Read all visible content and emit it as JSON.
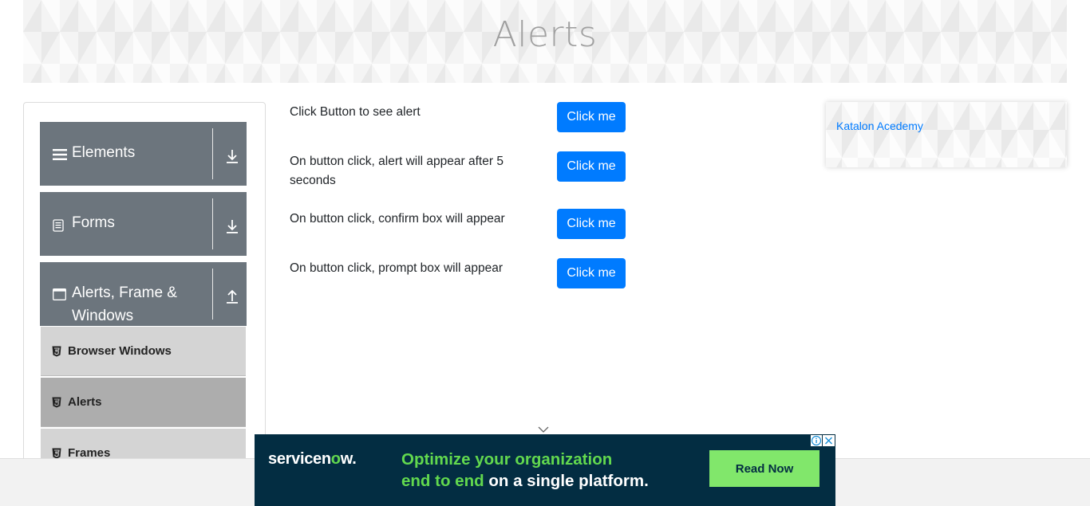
{
  "header": {
    "title": "Alerts"
  },
  "sidebar": {
    "groups": [
      {
        "label": "Elements",
        "icon": "hamburger-icon",
        "arrow": "download-arrow-icon"
      },
      {
        "label": "Forms",
        "icon": "document-icon",
        "arrow": "download-arrow-icon"
      },
      {
        "label": "Alerts, Frame &",
        "label_line2": "Windows",
        "icon": "window-icon",
        "arrow": "upload-arrow-icon"
      }
    ],
    "items": [
      {
        "label": "Browser Windows",
        "icon": "html5-icon",
        "active": false
      },
      {
        "label": "Alerts",
        "icon": "html5-icon",
        "active": true
      },
      {
        "label": "Frames",
        "icon": "html5-icon",
        "active": false
      }
    ]
  },
  "main": {
    "rows": [
      {
        "text": "Click Button to see alert",
        "button": "Click me"
      },
      {
        "text": "On button click, alert will appear after 5 seconds",
        "button": "Click me"
      },
      {
        "text": "On button click, confirm box will appear",
        "button": "Click me"
      },
      {
        "text": "On button click, prompt box will appear",
        "button": "Click me"
      }
    ]
  },
  "right_card": {
    "link": "Katalon Acedemy"
  },
  "ad": {
    "logo_pre": "servicen",
    "logo_o": "o",
    "logo_post": "w.",
    "line1": "Optimize your organization",
    "line2_green": "end to end",
    "line2_white": " on a single platform.",
    "cta": "Read Now"
  },
  "colors": {
    "primary": "#007bff",
    "sidebar_header": "#6c757d",
    "sidebar_item": "#d4d4d4",
    "sidebar_item_active": "#adadad",
    "ad_bg": "#032d42",
    "ad_accent": "#62d84e"
  }
}
